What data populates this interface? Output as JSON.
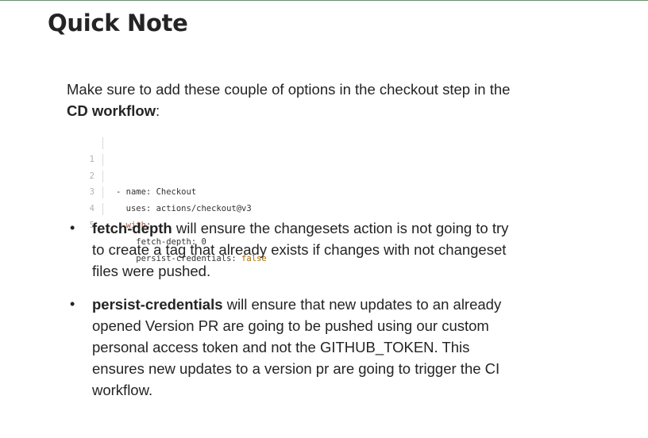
{
  "title": "Quick Note",
  "intro": {
    "before": "Make sure to add these couple of options in the checkout step in the ",
    "bold": "CD workflow",
    "after": ":"
  },
  "code": {
    "line_numbers": [
      "1",
      "2",
      "3",
      "4",
      "5"
    ],
    "lines": [
      {
        "text": "- name: Checkout",
        "value": ""
      },
      {
        "text": "  uses: actions/checkout@v3",
        "value": ""
      },
      {
        "text": "  ",
        "keyword": "with",
        "tail": ":"
      },
      {
        "text": "    fetch-depth: 0",
        "value": ""
      },
      {
        "text": "    persist-credentials: ",
        "value": "false"
      }
    ]
  },
  "bullets": [
    {
      "term": "fetch-depth",
      "text": " will ensure the changesets action is not going to try to create a tag that already exists if changes with not changeset files were pushed."
    },
    {
      "term": "persist-credentials",
      "text": " will ensure that new updates to an already opened Version PR are going to be pushed using our custom personal access token and not the GITHUB_TOKEN. This ensures new updates to a version pr are going to trigger the CI workflow."
    }
  ],
  "colors": {
    "text": "#242424",
    "keyword": "#a05a3c",
    "boolean": "#a86a00",
    "line_number": "#b0b0b0"
  }
}
